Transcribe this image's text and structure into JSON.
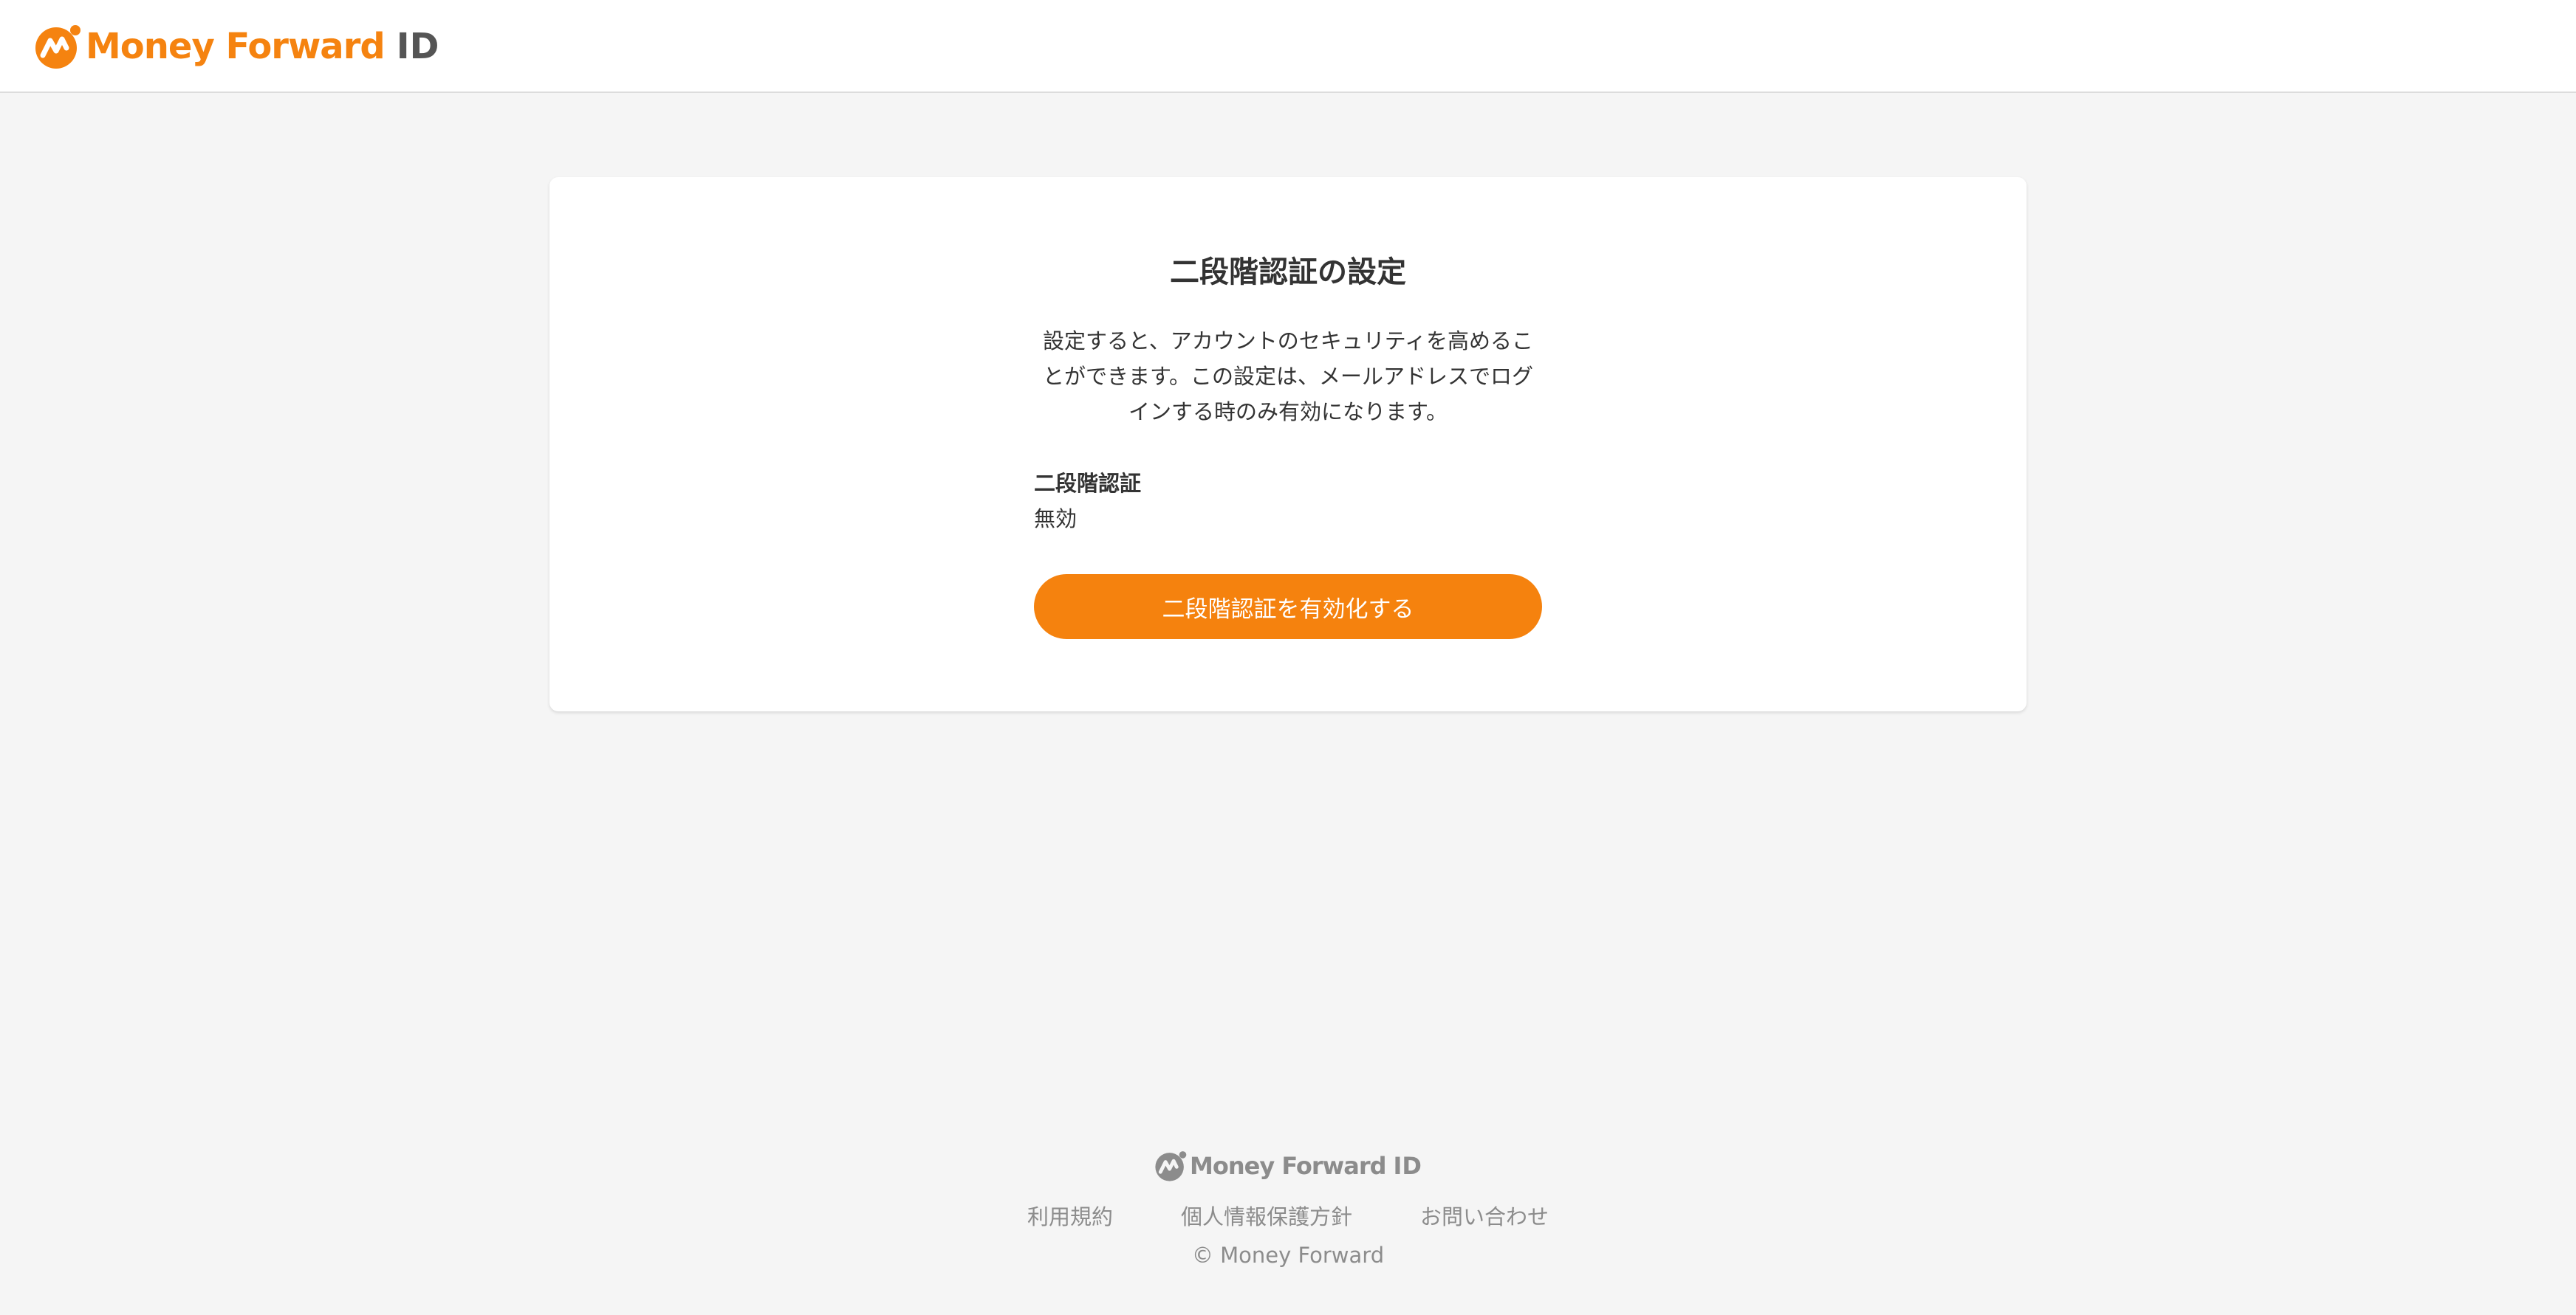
{
  "header": {
    "brand_name": "Money Forward",
    "brand_suffix": "ID",
    "brand_color": "#f58310"
  },
  "card": {
    "title": "二段階認証の設定",
    "description": "設定すると、アカウントのセキュリティを高めることができます。この設定は、メールアドレスでログインする時のみ有効になります。",
    "setting_label": "二段階認証",
    "setting_value": "無効",
    "enable_button_label": "二段階認証を有効化する",
    "button_color": "#f5820e"
  },
  "footer": {
    "brand_name": "Money Forward",
    "brand_suffix": "ID",
    "links": [
      {
        "label": "利用規約"
      },
      {
        "label": "個人情報保護方針"
      },
      {
        "label": "お問い合わせ"
      }
    ],
    "copyright": "© Money Forward"
  }
}
